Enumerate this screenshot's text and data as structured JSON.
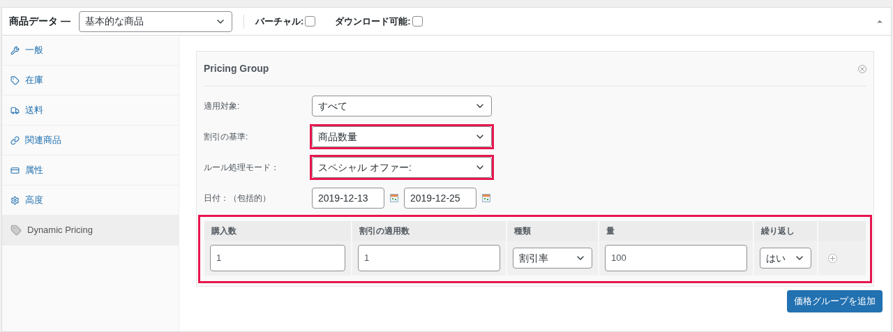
{
  "header": {
    "title": "商品データ —",
    "product_type": {
      "value": "基本的な商品"
    },
    "options": [
      {
        "label": "バーチャル:",
        "checked": false
      },
      {
        "label": "ダウンロード可能:",
        "checked": false
      }
    ]
  },
  "sidebar": {
    "items": [
      {
        "label": "一般",
        "selected": false
      },
      {
        "label": "在庫",
        "selected": false
      },
      {
        "label": "送料",
        "selected": false
      },
      {
        "label": "関連商品",
        "selected": false
      },
      {
        "label": "属性",
        "selected": false
      },
      {
        "label": "高度",
        "selected": false
      },
      {
        "label": "Dynamic Pricing",
        "selected": true
      }
    ]
  },
  "pricing_group": {
    "title": "Pricing Group",
    "fields": [
      {
        "kind": "select",
        "label": "適用対象:",
        "value": "すべて",
        "highlighted": false
      },
      {
        "kind": "select",
        "label": "割引の基準:",
        "value": "商品数量",
        "highlighted": true
      },
      {
        "kind": "select",
        "label": "ルール処理モード：",
        "value": "スペシャル オファー:",
        "highlighted": true
      },
      {
        "kind": "dates",
        "label": "日付：（包括的）",
        "from": "2019-12-13",
        "to": "2019-12-25",
        "highlighted": false
      }
    ],
    "rules": {
      "highlighted": true,
      "columns": [
        "購入数",
        "割引の適用数",
        "種類",
        "量",
        "繰り返し"
      ],
      "row": [
        {
          "kind": "input",
          "value": "1"
        },
        {
          "kind": "input",
          "value": "1"
        },
        {
          "kind": "select",
          "value": "割引率"
        },
        {
          "kind": "input",
          "value": "100"
        },
        {
          "kind": "select",
          "value": "はい"
        }
      ]
    }
  },
  "add_button": "価格グループを追加"
}
